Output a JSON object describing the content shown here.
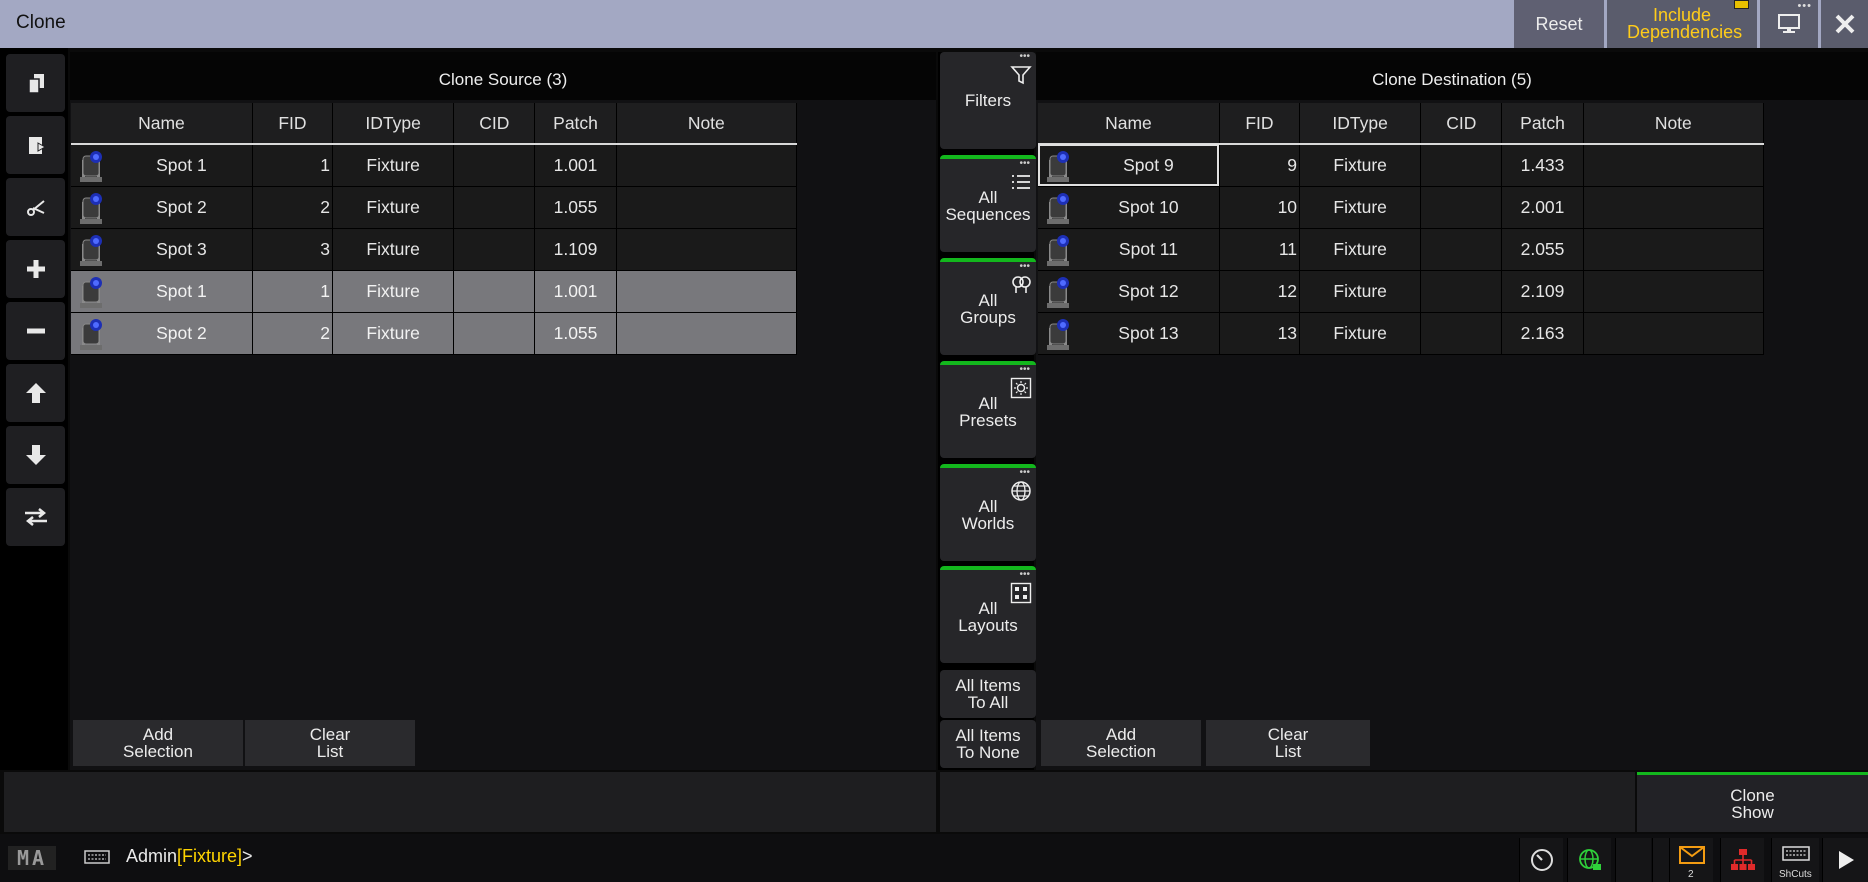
{
  "window": {
    "title": "Clone"
  },
  "titlebar": {
    "reset_label": "Reset",
    "include_dependencies_label": "Include Dependencies",
    "accent_yellow": "#ffcc1a"
  },
  "source": {
    "title": "Clone Source (3)",
    "columns": [
      "Name",
      "FID",
      "IDType",
      "CID",
      "Patch",
      "Note"
    ],
    "rows": [
      {
        "name": "Spot 1",
        "fid": "1",
        "idtype": "Fixture",
        "cid": "",
        "patch": "1.001",
        "note": "",
        "selected": false
      },
      {
        "name": "Spot 2",
        "fid": "2",
        "idtype": "Fixture",
        "cid": "",
        "patch": "1.055",
        "note": "",
        "selected": false
      },
      {
        "name": "Spot 3",
        "fid": "3",
        "idtype": "Fixture",
        "cid": "",
        "patch": "1.109",
        "note": "",
        "selected": false
      },
      {
        "name": "Spot 1",
        "fid": "1",
        "idtype": "Fixture",
        "cid": "",
        "patch": "1.001",
        "note": "",
        "selected": true
      },
      {
        "name": "Spot 2",
        "fid": "2",
        "idtype": "Fixture",
        "cid": "",
        "patch": "1.055",
        "note": "",
        "selected": true
      }
    ],
    "add_selection_label": "Add Selection",
    "clear_list_label": "Clear List"
  },
  "destination": {
    "title": "Clone Destination (5)",
    "columns": [
      "Name",
      "FID",
      "IDType",
      "CID",
      "Patch",
      "Note"
    ],
    "rows": [
      {
        "name": "Spot 9",
        "fid": "9",
        "idtype": "Fixture",
        "cid": "",
        "patch": "1.433",
        "note": ""
      },
      {
        "name": "Spot 10",
        "fid": "10",
        "idtype": "Fixture",
        "cid": "",
        "patch": "2.001",
        "note": ""
      },
      {
        "name": "Spot 11",
        "fid": "11",
        "idtype": "Fixture",
        "cid": "",
        "patch": "2.055",
        "note": ""
      },
      {
        "name": "Spot 12",
        "fid": "12",
        "idtype": "Fixture",
        "cid": "",
        "patch": "2.109",
        "note": ""
      },
      {
        "name": "Spot 13",
        "fid": "13",
        "idtype": "Fixture",
        "cid": "",
        "patch": "2.163",
        "note": ""
      }
    ],
    "add_selection_label": "Add Selection",
    "clear_list_label": "Clear List"
  },
  "filters": {
    "filters_label": "Filters",
    "all_sequences_label": "All Sequences",
    "all_groups_label": "All Groups",
    "all_presets_label": "All Presets",
    "all_worlds_label": "All Worlds",
    "all_layouts_label": "All Layouts",
    "all_items_to_all_label": "All Items To All",
    "all_items_to_none_label": "All Items To None",
    "active_color": "#13b71d"
  },
  "actions": {
    "clone_show_label": "Clone Show"
  },
  "commandline": {
    "logo": "MA",
    "user": "Admin",
    "context": "[Fixture]",
    "prompt": ">",
    "mail_count": "2",
    "shortcuts_label": "ShCuts"
  }
}
